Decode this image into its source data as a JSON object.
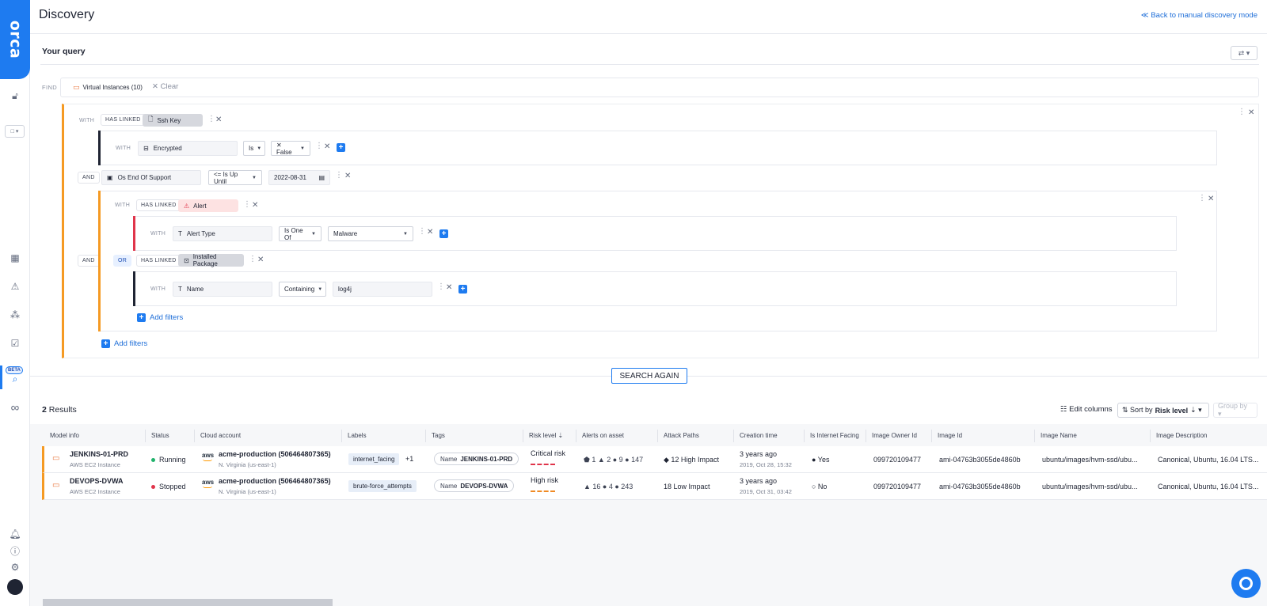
{
  "sidebar": {
    "logo": "orca",
    "selector": "□ ▾",
    "beta": "BETA",
    "icons": [
      "lock-icon",
      "dashboard-icon",
      "alert-icon",
      "graph-icon",
      "clipboard-icon",
      "discovery-icon",
      "infinity-icon",
      "bell-icon",
      "help-icon",
      "settings-icon",
      "avatar"
    ]
  },
  "header": {
    "title": "Discovery",
    "back_link": "≪ Back to manual discovery mode"
  },
  "query": {
    "title": "Your query",
    "settings": "⇄ ▾",
    "find_label": "FIND",
    "find_target": "Virtual Instances (10)",
    "clear": "✕ Clear",
    "group1": {
      "with": "WITH",
      "has_linked": "HAS LINKED",
      "entity": "Ssh Key",
      "inner": {
        "with": "WITH",
        "field": "Encrypted",
        "op": "Is",
        "value": "✕ False"
      }
    },
    "and_row": {
      "label": "AND",
      "field": "Os End Of Support",
      "op": "<= Is Up Until",
      "value": "2022-08-31"
    },
    "group2": {
      "and_label": "AND",
      "with": "WITH",
      "has_linked": "HAS LINKED",
      "entity": "Alert",
      "inner": {
        "with": "WITH",
        "field": "Alert Type",
        "op": "Is One Of",
        "value": "Malware"
      },
      "or": "OR",
      "has_linked2": "HAS LINKED",
      "entity2": "Installed Package",
      "inner2": {
        "with": "WITH",
        "field": "Name",
        "op": "Containing",
        "value": "log4j"
      },
      "add_filters": "Add filters"
    },
    "add_filters": "Add filters",
    "search_again": "SEARCH AGAIN"
  },
  "results": {
    "count": "2",
    "count_label": "Results",
    "edit_columns": "Edit columns",
    "sort_prefix": "⇅ Sort by",
    "sort_value": "Risk level",
    "sort_suffix": "⇣ ▾",
    "group_by": "Group by ▾",
    "columns": [
      "Model info",
      "Status",
      "Cloud account",
      "Labels",
      "Tags",
      "Risk level ⇣",
      "Alerts on asset",
      "Attack Paths",
      "Creation time",
      "Is Internet Facing",
      "Image Owner Id",
      "Image Id",
      "Image Name",
      "Image Description"
    ],
    "rows": [
      {
        "name": "JENKINS-01-PRD",
        "model": "AWS EC2 Instance",
        "status": "Running",
        "status_color": "#20b26b",
        "aws": "aws",
        "account": "acme-production (506464807365)",
        "region": "N. Virginia  (us-east-1)",
        "label": "internet_facing",
        "label_more": "+1",
        "tag_key": "Name",
        "tag_value": "JENKINS-01-PRD",
        "risk": "Critical risk",
        "risk_color": "#e0344a",
        "alerts": "⬟ 1  ▲ 2  ● 9  ● 147",
        "attack": "◆ 12 High Impact",
        "created": "3 years ago",
        "created_sub": "2019, Oct 28, 15:32",
        "internet": "● Yes",
        "owner": "099720109477",
        "image_id": "ami-04763b3055de4860b",
        "image_name": "ubuntu/images/hvm-ssd/ubu...",
        "image_desc": "Canonical, Ubuntu, 16.04 LTS..."
      },
      {
        "name": "DEVOPS-DVWA",
        "model": "AWS EC2 Instance",
        "status": "Stopped",
        "status_color": "#e0344a",
        "aws": "aws",
        "account": "acme-production (506464807365)",
        "region": "N. Virginia  (us-east-1)",
        "label": "brute-force_attempts",
        "label_more": "",
        "tag_key": "Name",
        "tag_value": "DEVOPS-DVWA",
        "risk": "High risk",
        "risk_color": "#f08a24",
        "alerts": "▲ 16  ● 4  ● 243",
        "attack": "18 Low Impact",
        "created": "3 years ago",
        "created_sub": "2019, Oct 31, 03:42",
        "internet": "○ No",
        "owner": "099720109477",
        "image_id": "ami-04763b3055de4860b",
        "image_name": "ubuntu/images/hvm-ssd/ubu...",
        "image_desc": "Canonical, Ubuntu, 16.04 LTS..."
      }
    ]
  },
  "colors": {
    "accent": "#1e7bf0",
    "orange": "#f59a23",
    "critical": "#e0344a",
    "high": "#f08a24"
  }
}
